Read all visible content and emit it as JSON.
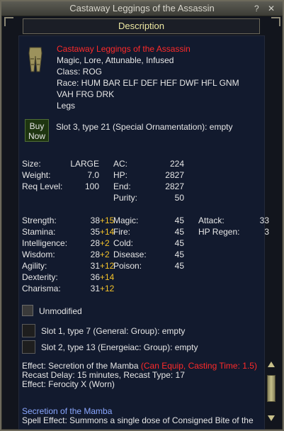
{
  "window": {
    "title": "Castaway Leggings of the Assassin",
    "help_glyph": "?",
    "close_glyph": "✕"
  },
  "tab": {
    "label": "Description"
  },
  "item": {
    "name": "Castaway Leggings of the Assassin",
    "flags": "Magic, Lore, Attunable, Infused",
    "class_line": "Class: ROG",
    "race_line1": "Race: HUM BAR ELF DEF HEF DWF HFL GNM",
    "race_line2": "VAH FRG DRK",
    "slot_line": "Legs",
    "icon": "leggings-icon"
  },
  "buy": {
    "line1": "Buy",
    "line2": "Now"
  },
  "ornament_slot": "Slot 3, type 21 (Special Ornamentation): empty",
  "basic_stats": {
    "left": [
      {
        "label": "Size:",
        "value": "LARGE"
      },
      {
        "label": "Weight:",
        "value": "7.0"
      },
      {
        "label": "Req Level:",
        "value": "100"
      }
    ],
    "right": [
      {
        "label": "AC:",
        "value": "224"
      },
      {
        "label": "HP:",
        "value": "2827"
      },
      {
        "label": "End:",
        "value": "2827"
      },
      {
        "label": "Purity:",
        "value": "50"
      }
    ]
  },
  "attributes": [
    {
      "label": "Strength:",
      "base": "38",
      "bonus": "+15"
    },
    {
      "label": "Stamina:",
      "base": "35",
      "bonus": "+14"
    },
    {
      "label": "Intelligence:",
      "base": "28",
      "bonus": "+2"
    },
    {
      "label": "Wisdom:",
      "base": "28",
      "bonus": "+2"
    },
    {
      "label": "Agility:",
      "base": "31",
      "bonus": "+12"
    },
    {
      "label": "Dexterity:",
      "base": "36",
      "bonus": "+14"
    },
    {
      "label": "Charisma:",
      "base": "31",
      "bonus": "+12"
    }
  ],
  "resists": [
    {
      "label": "Magic:",
      "value": "45"
    },
    {
      "label": "Fire:",
      "value": "45"
    },
    {
      "label": "Cold:",
      "value": "45"
    },
    {
      "label": "Disease:",
      "value": "45"
    },
    {
      "label": "Poison:",
      "value": "45"
    }
  ],
  "extras": [
    {
      "label": "Attack:",
      "value": "33"
    },
    {
      "label": "HP Regen:",
      "value": "3"
    }
  ],
  "modification": {
    "label": "Unmodified"
  },
  "aug_slots": [
    "Slot 1, type 7 (General: Group): empty",
    "Slot 2, type 13 (Energeiac: Group): empty"
  ],
  "effect": {
    "line1_prefix": "Effect: Secretion of the Mamba ",
    "line1_red": "(Can Equip, Casting Time: 1.5)",
    "line2": "Recast Delay: 15 minutes, Recast Type: 17",
    "line3": "Effect: Ferocity X (Worn)"
  },
  "spell": {
    "title": "Secretion of the Mamba",
    "line": "Spell Effect: Summons a single dose of Consigned Bite of the"
  },
  "colors": {
    "item_name": "#ff2a2a",
    "stat_bonus": "#f3c22a",
    "spell_title": "#8aa7ff",
    "tab_text": "#ede8a2"
  }
}
